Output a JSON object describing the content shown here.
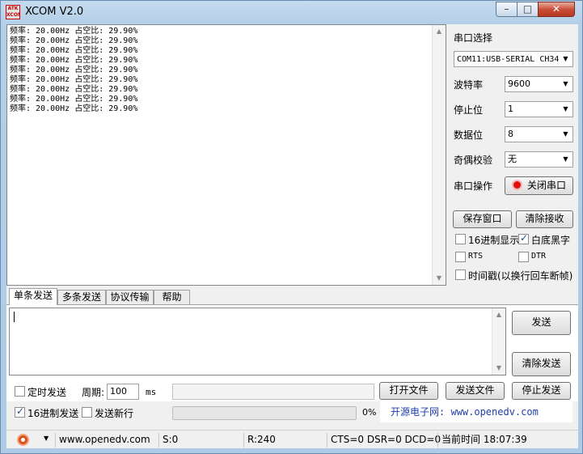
{
  "window": {
    "title": "XCOM V2.0",
    "logo_text": "ATK XCOM",
    "controls": {
      "minimize": "–",
      "maximize": "□",
      "close": "✕"
    }
  },
  "receive": {
    "lines": [
      "频率: 20.00Hz 占空比: 29.90%",
      "频率: 20.00Hz 占空比: 29.90%",
      "频率: 20.00Hz 占空比: 29.90%",
      "频率: 20.00Hz 占空比: 29.90%",
      "频率: 20.00Hz 占空比: 29.90%",
      "频率: 20.00Hz 占空比: 29.90%",
      "频率: 20.00Hz 占空比: 29.90%",
      "频率: 20.00Hz 占空比: 29.90%",
      "频率: 20.00Hz 占空比: 29.90%"
    ]
  },
  "settings": {
    "port_label": "串口选择",
    "port_value": "COM11:USB-SERIAL CH34",
    "baud_label": "波特率",
    "baud_value": "9600",
    "stop_label": "停止位",
    "stop_value": "1",
    "data_label": "数据位",
    "data_value": "8",
    "parity_label": "奇偶校验",
    "parity_value": "无",
    "op_label": "串口操作",
    "op_button": "关闭串口",
    "save_button": "保存窗口",
    "clear_recv_button": "清除接收",
    "hex_display_label": "16进制显示",
    "hex_display_checked": false,
    "white_black_label": "白底黑字",
    "white_black_checked": true,
    "rts_label": "RTS",
    "dtr_label": "DTR",
    "timestamp_label": "时间戳(以换行回车断帧)"
  },
  "tabs": [
    {
      "label": "单条发送",
      "active": true
    },
    {
      "label": "多条发送",
      "active": false
    },
    {
      "label": "协议传输",
      "active": false
    },
    {
      "label": "帮助",
      "active": false
    }
  ],
  "send": {
    "text": "",
    "send_button": "发送",
    "clear_send_button": "清除发送",
    "timed_label": "定时发送",
    "period_label": "周期:",
    "period_value": "100",
    "period_unit": "ms",
    "hex_send_label": "16进制发送",
    "hex_send_checked": true,
    "newline_label": "发送新行",
    "open_file_button": "打开文件",
    "send_file_button": "发送文件",
    "stop_send_button": "停止发送",
    "progress_percent": "0%",
    "site_text": "开源电子网: www.openedv.com"
  },
  "status": {
    "url": "www.openedv.com",
    "sent": "S:0",
    "received": "R:240",
    "lines": "CTS=0 DSR=0 DCD=0",
    "time": "当前时间 18:07:39"
  },
  "colors": {
    "title_bar": "#b4cfe8",
    "close_button": "#c74a34",
    "link_blue": "#1f3fa8",
    "serial_on_indicator": "#e01010"
  }
}
